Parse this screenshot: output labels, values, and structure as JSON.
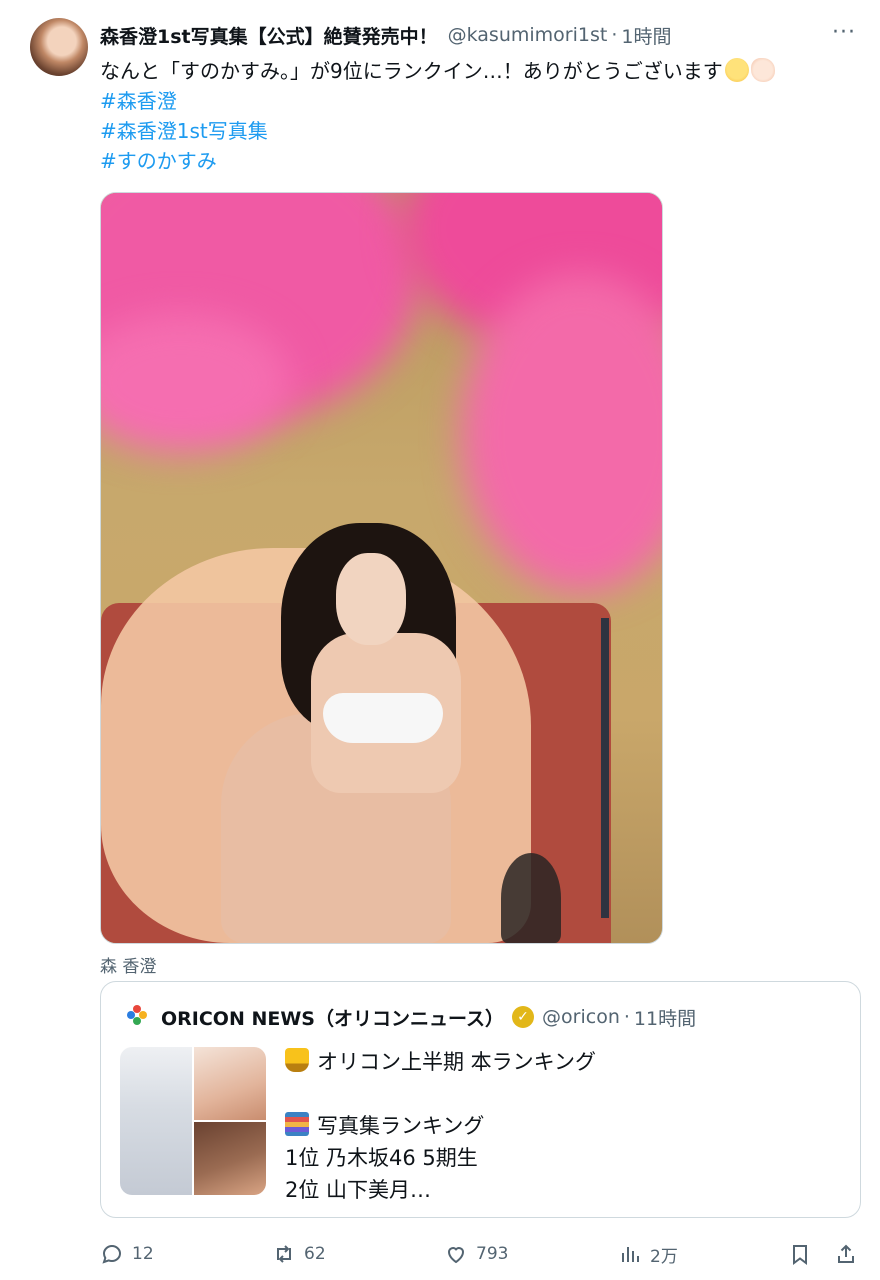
{
  "tweet": {
    "author_name": "森香澄1st写真集【公式】絶賛発売中！",
    "author_handle": "@kasumimori1st",
    "separator": "·",
    "time": "1時間",
    "more_label": "···",
    "text": "なんと「すのかすみ。」が9位にランクイン…！ありがとうございます",
    "emojis": [
      "pleading-face",
      "clapping-hands"
    ],
    "hashtags": [
      "#森香澄",
      "#森香澄1st写真集",
      "#すのかすみ"
    ],
    "photo_tag": "森 香澄"
  },
  "quote": {
    "author_name": "ORICON NEWS（オリコンニュース）",
    "verified_badge": "✓",
    "author_handle": "@oricon",
    "separator": "·",
    "time": "11時間",
    "lines": [
      "オリコン上半期 本ランキング",
      "",
      "写真集ランキング",
      "1位 乃木坂46 5期生",
      "2位 山下美月…"
    ],
    "line_icons": [
      "trophy",
      "books"
    ]
  },
  "actions": {
    "reply_count": "12",
    "retweet_count": "62",
    "like_count": "793",
    "view_count": "2万"
  },
  "colors": {
    "link": "#1d9bf0",
    "muted": "#536471",
    "text": "#0f1419",
    "border": "#cfd9de"
  }
}
